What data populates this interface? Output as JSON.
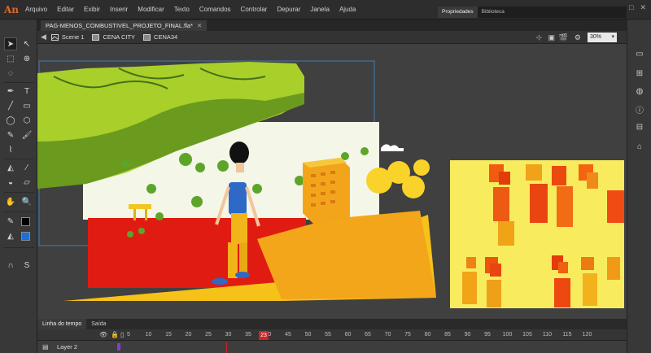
{
  "app": {
    "logo": "An",
    "menu": [
      "Arquivo",
      "Editar",
      "Exibir",
      "Inserir",
      "Modificar",
      "Texto",
      "Comandos",
      "Controlar",
      "Depurar",
      "Janela",
      "Ajuda"
    ],
    "window_controls": [
      "–",
      "□",
      "✕"
    ]
  },
  "document": {
    "tab_label": "PAG-MENOS_COMBUSTIVEL_PROJETO_FINAL.fla*",
    "tab_close": "✕"
  },
  "editbar": {
    "crumbs": [
      "Scene 1",
      "CENA CITY",
      "CENA34"
    ],
    "zoom": "30%"
  },
  "panels": {
    "right_tabs": [
      "Propriedades",
      "Biblioteca"
    ]
  },
  "timeline": {
    "tabs": [
      "Linha do tempo",
      "Saída"
    ],
    "frame_numbers": [
      "5",
      "10",
      "15",
      "20",
      "25",
      "30",
      "35",
      "40",
      "45",
      "50",
      "55",
      "60",
      "65",
      "70",
      "75",
      "80",
      "85",
      "90",
      "95",
      "100",
      "105",
      "110",
      "115",
      "120"
    ],
    "current_frame": "23",
    "layer_name": "Layer 2"
  },
  "colors": {
    "accent_red": "#c9262a",
    "stage_yellow": "#f9ef62",
    "stage_red": "#e01c12"
  }
}
